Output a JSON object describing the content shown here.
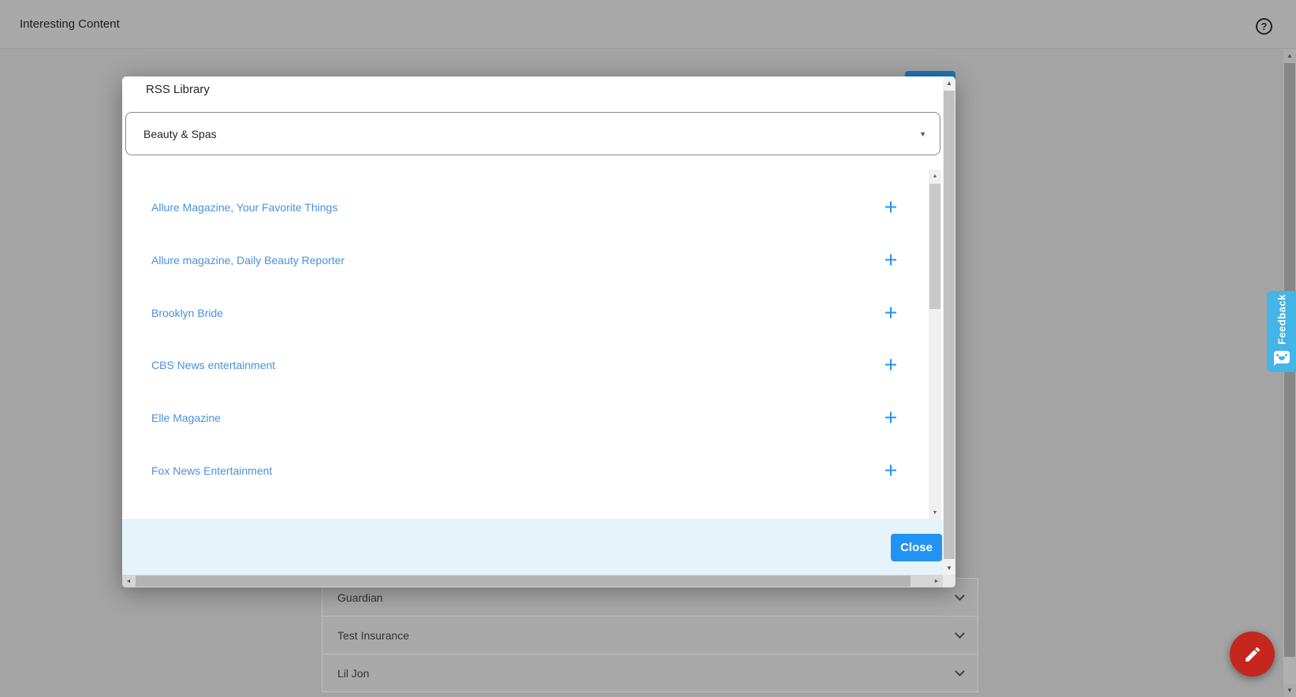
{
  "header": {
    "title": "Interesting Content"
  },
  "modal": {
    "title": "RSS Library",
    "category": {
      "value": "Beauty & Spas"
    },
    "feeds": [
      {
        "name": "Allure Magazine, Your Favorite Things"
      },
      {
        "name": "Allure magazine, Daily Beauty Reporter"
      },
      {
        "name": "Brooklyn Bride"
      },
      {
        "name": "CBS News entertainment"
      },
      {
        "name": "Elle Magazine"
      },
      {
        "name": "Fox News Entertainment"
      }
    ],
    "footer": {
      "close_label": "Close"
    }
  },
  "page": {
    "accordion": [
      {
        "label": "Guardian"
      },
      {
        "label": "Test Insurance"
      },
      {
        "label": "Lil Jon"
      }
    ]
  },
  "feedback": {
    "label": "Feedback"
  },
  "icons": {
    "plus": "+",
    "help": "?",
    "caret_down": "▼",
    "arrow_up": "▲",
    "arrow_down": "▼",
    "arrow_left": "◄",
    "arrow_right": "►"
  },
  "colors": {
    "accent_blue": "#2193f3",
    "link_blue": "#4a90dc",
    "footer_bg": "#e7f3fb",
    "feedback_blue": "#44b5e7",
    "fab_red": "#c5261d",
    "peek_button_blue": "#1b74ba"
  }
}
